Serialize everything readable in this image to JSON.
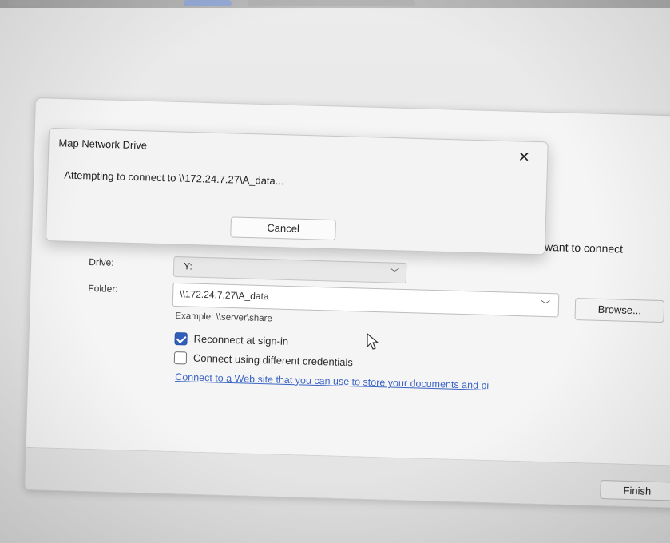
{
  "background_window": {
    "prompt_partial": "want to connect",
    "drive": {
      "label": "Drive:",
      "value": "Y:"
    },
    "folder": {
      "label": "Folder:",
      "value": "\\\\172.24.7.27\\A_data"
    },
    "browse_label": "Browse...",
    "example_text": "Example: \\\\server\\share",
    "reconnect": {
      "label": "Reconnect at sign-in",
      "checked": true
    },
    "different_credentials": {
      "label": "Connect using different credentials",
      "checked": false
    },
    "web_link_text": "Connect to a Web site that you can use to store your documents and pi",
    "finish_label": "Finish"
  },
  "dialog": {
    "title": "Map Network Drive",
    "close_glyph": "✕",
    "message": "Attempting to connect to \\\\172.24.7.27\\A_data...",
    "cancel_label": "Cancel"
  },
  "colors": {
    "checkbox_accent": "#2f5fb8",
    "link": "#3b64c5",
    "background": "#e9e9e9"
  },
  "icons": {
    "close": "close-icon",
    "chevron": "chevron-down-icon",
    "cursor": "mouse-pointer-icon"
  }
}
